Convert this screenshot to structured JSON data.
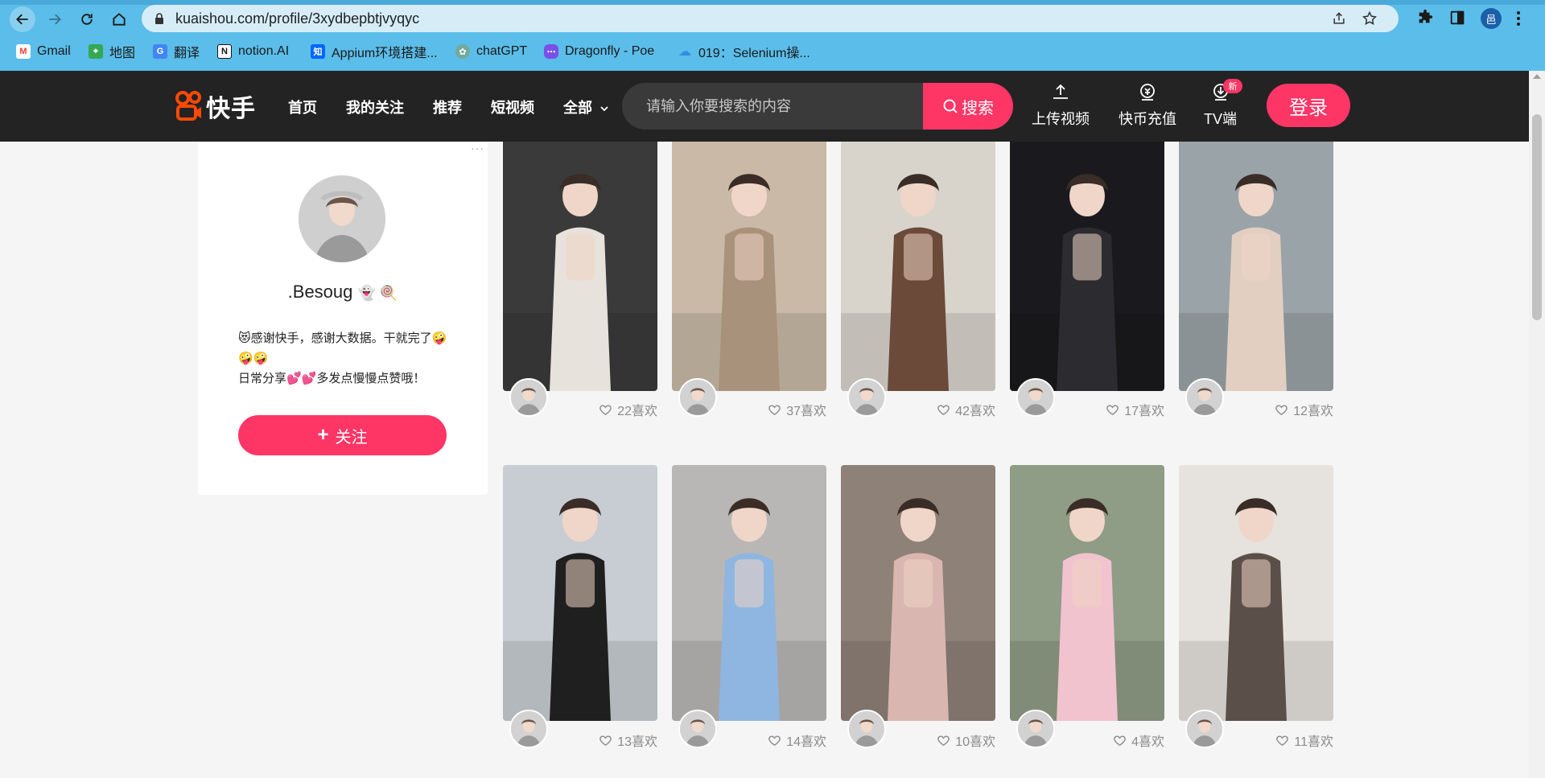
{
  "browser": {
    "url": "kuaishou.com/profile/3xydbepbtjvyqyc",
    "profile_initial": "邑",
    "bookmarks": [
      {
        "label": "Gmail",
        "icon": "gmail-icon",
        "color": "#ea4335"
      },
      {
        "label": "地图",
        "icon": "maps-icon",
        "color": "#34a853"
      },
      {
        "label": "翻译",
        "icon": "translate-icon",
        "color": "#4285f4"
      },
      {
        "label": "notion.AI",
        "icon": "notion-icon",
        "color": "#111111"
      },
      {
        "label": "Appium环境搭建...",
        "icon": "zhihu-icon",
        "color": "#0066ff"
      },
      {
        "label": "chatGPT",
        "icon": "chatgpt-icon",
        "color": "#74aa9c"
      },
      {
        "label": "Dragonfly - Poe",
        "icon": "poe-icon",
        "color": "#7a4ee8"
      },
      {
        "label": "019：Selenium操...",
        "icon": "cloud-icon",
        "color": "#2f8fe0"
      }
    ]
  },
  "header": {
    "logo_text": "快手",
    "nav": [
      "首页",
      "我的关注",
      "推荐",
      "短视频",
      "全部"
    ],
    "search_placeholder": "请输入你要搜索的内容",
    "search_button": "搜索",
    "upload": "上传视频",
    "recharge": "快币充值",
    "tv": "TV端",
    "tv_badge": "新",
    "login": "登录",
    "accent": "#fe3666"
  },
  "profile": {
    "name": ".Besoug",
    "name_emoji": "👻 🍭",
    "bio_line1": "😻感谢快手，感谢大数据。干就完了🤪🤪🤪",
    "bio_line2": "日常分享💕💕多发点慢慢点赞哦！",
    "follow_label": "关注"
  },
  "videos": [
    {
      "likes": "22喜欢",
      "bg": "#3a3a3a",
      "figure": "#e8e2dc"
    },
    {
      "likes": "37喜欢",
      "bg": "#c9b9a6",
      "figure": "#a8927c"
    },
    {
      "likes": "42喜欢",
      "bg": "#d8d4cc",
      "figure": "#6b4a3a"
    },
    {
      "likes": "17喜欢",
      "bg": "#1a1a1e",
      "figure": "#2b2b30"
    },
    {
      "likes": "12喜欢",
      "bg": "#9aa3a8",
      "figure": "#e2cfc2"
    },
    {
      "likes": "13喜欢",
      "bg": "#c7cdd2",
      "figure": "#1f1f1f"
    },
    {
      "likes": "14喜欢",
      "bg": "#b9b7b5",
      "figure": "#8fb6e0"
    },
    {
      "likes": "10喜欢",
      "bg": "#8e8178",
      "figure": "#d9b7b0"
    },
    {
      "likes": "4喜欢",
      "bg": "#8f9c86",
      "figure": "#f1c3cf"
    },
    {
      "likes": "11喜欢",
      "bg": "#e6e2dd",
      "figure": "#5b4f4a"
    }
  ]
}
